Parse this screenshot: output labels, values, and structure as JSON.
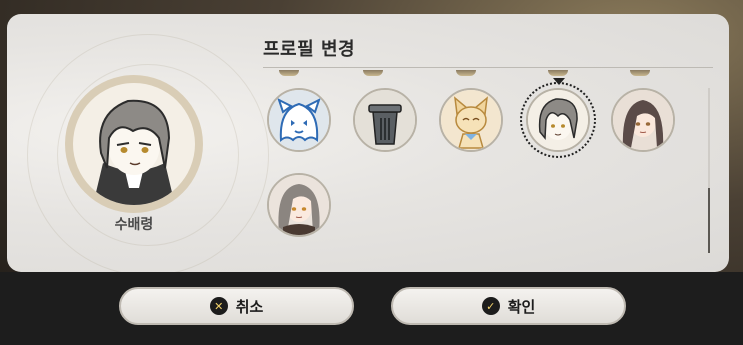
{
  "dialog": {
    "title": "프로필 변경",
    "current_name": "수배령"
  },
  "avatars": [
    {
      "name": "ghost-cat-avatar",
      "selected": false
    },
    {
      "name": "trash-can-avatar",
      "selected": false
    },
    {
      "name": "fox-avatar",
      "selected": false
    },
    {
      "name": "gray-hair-chibi-avatar",
      "selected": true
    },
    {
      "name": "dark-hair-girl-avatar",
      "selected": false
    },
    {
      "name": "gray-hair-girl-avatar",
      "selected": false
    }
  ],
  "buttons": {
    "cancel_label": "취소",
    "confirm_label": "확인",
    "cancel_icon": "x-circle-icon",
    "confirm_icon": "check-circle-icon"
  },
  "colors": {
    "panel": "#e6e4e1",
    "bottom_bar": "#1d1d1d",
    "icon_accent": "#f3d36b"
  }
}
